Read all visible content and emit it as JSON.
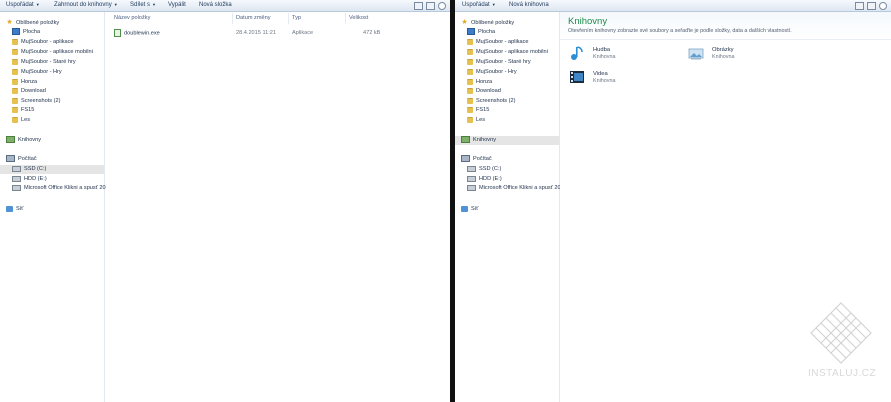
{
  "left": {
    "toolbar": {
      "organize": "Uspořádat",
      "include": "Zahrnout do knihovny",
      "share": "Sdílet s",
      "burn": "Vypálit",
      "new_folder": "Nová složka"
    },
    "nav": {
      "favorites": "Oblíbené položky",
      "items": [
        "Plocha",
        "MujSoubor - aplikace",
        "MujSoubor - aplikace mobilni",
        "MujSoubor - Staré hry",
        "MujSoubor - Hry",
        "Honza",
        "Download",
        "Screenshots (2)",
        "FS15",
        "Les"
      ],
      "libraries": "Knihovny",
      "computer": "Počítač",
      "drives": [
        "SSD (C:)",
        "HDD (E:)",
        "Microsoft Office Klikni a spusť 20"
      ],
      "network": "Síť"
    },
    "columns": [
      "Název položky",
      "Datum změny",
      "Typ",
      "Velikost"
    ],
    "files": [
      {
        "name": "doublewin.exe",
        "date": "28.4.2015 11:21",
        "type": "Aplikace",
        "size": "472 kB"
      }
    ]
  },
  "right": {
    "toolbar": {
      "organize": "Uspořádat",
      "new_library": "Nová knihovna"
    },
    "nav": {
      "favorites": "Oblíbené položky",
      "items": [
        "Plocha",
        "MujSoubor - aplikace",
        "MujSoubor - aplikace mobilni",
        "MujSoubor - Staré hry",
        "MujSoubor - Hry",
        "Honza",
        "Download",
        "Screenshots (2)",
        "FS15",
        "Les"
      ],
      "libraries": "Knihovny",
      "computer": "Počítač",
      "drives": [
        "SSD (C:)",
        "HDD (E:)",
        "Microsoft Office Klikni a spusť 20"
      ],
      "network": "Síť"
    },
    "content": {
      "title": "Knihovny",
      "subtitle": "Otevřením knihovny zobrazte své soubory a seřaďte je podle složky, data a dalších vlastností.",
      "libraries": [
        {
          "name": "Hudba",
          "kind": "Knihovna"
        },
        {
          "name": "Obrázky",
          "kind": "Knihovna"
        },
        {
          "name": "Videa",
          "kind": "Knihovna"
        }
      ]
    }
  },
  "watermark": "INSTALUJ.CZ"
}
